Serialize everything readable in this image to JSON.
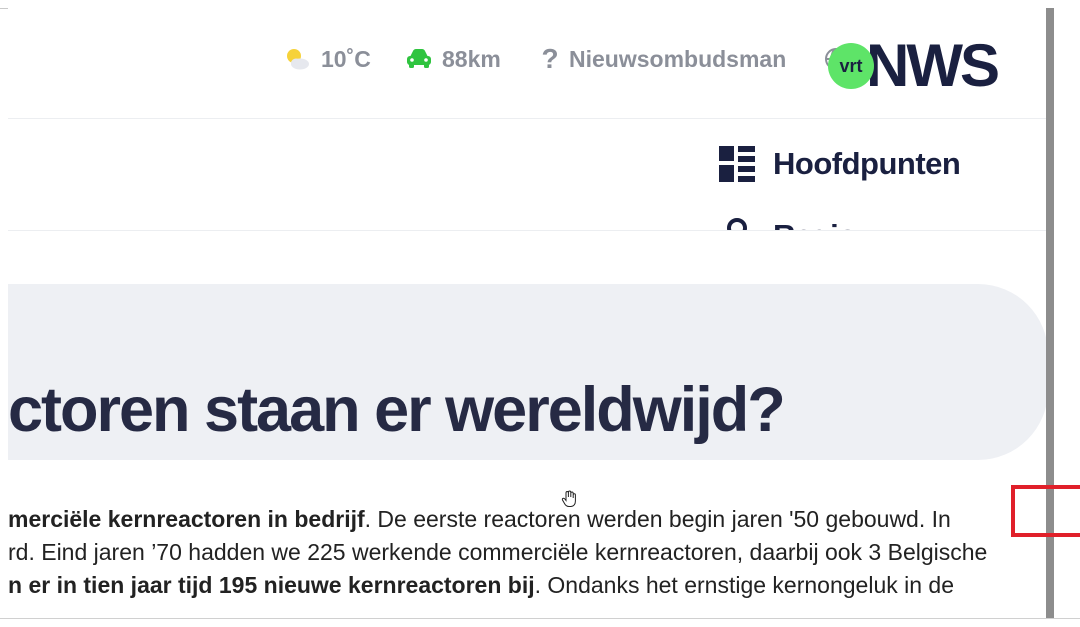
{
  "header": {
    "weather": {
      "icon": "partly-sunny-icon",
      "temperature": "10˚C"
    },
    "traffic": {
      "icon": "car-icon",
      "value": "88km"
    },
    "help": {
      "icon": "question-icon",
      "label": "Nieuwsombudsman"
    },
    "language": {
      "icon": "globe-icon"
    },
    "logo": {
      "vrt": "vrt",
      "nws": "NWS"
    }
  },
  "nav": {
    "items": [
      {
        "icon": "grid-list-icon",
        "label": "Hoofdpunten"
      },
      {
        "icon": "user-icon",
        "label": "Regio"
      }
    ]
  },
  "article": {
    "headline": "ctoren staan er wereldwijd?",
    "lines": [
      {
        "bold": "merciële kernreactoren in bedrijf",
        "text": ". De eerste reactoren werden begin jaren '50 gebouwd. In"
      },
      {
        "bold": "",
        "text": "rd. Eind jaren ’70 hadden we 225 werkende commerciële kernreactoren, daarbij ook 3 Belgische"
      },
      {
        "bold": "n er in tien jaar tijd 195 nieuwe kernreactoren bij",
        "text": ". Ondanks het ernstige kernongeluk in de"
      }
    ]
  },
  "colors": {
    "brand_navy": "#1a2040",
    "vrt_green": "#5ee468",
    "traffic_green": "#2fc43f",
    "muted_gray": "#8b8f99",
    "headline_bg": "#eef0f4",
    "annotation_red": "#e0202a"
  }
}
